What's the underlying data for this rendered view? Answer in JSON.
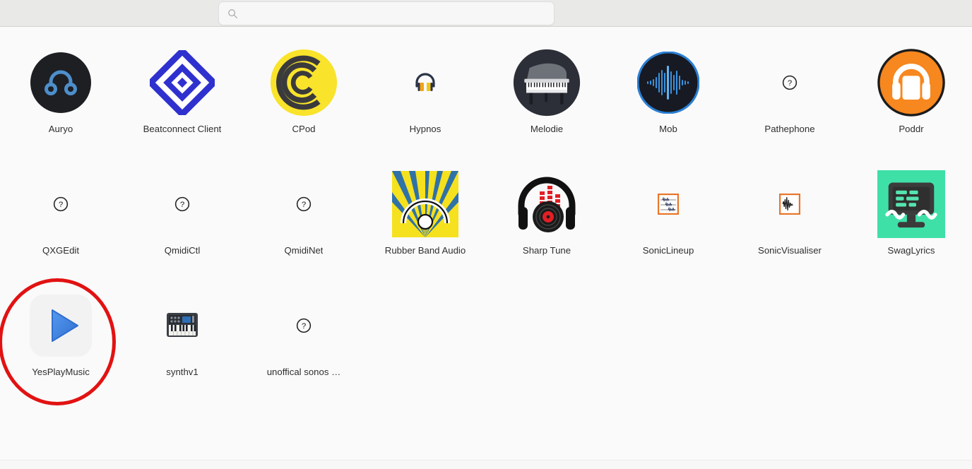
{
  "search": {
    "placeholder": "",
    "value": "",
    "icon": "search-icon"
  },
  "highlight": {
    "target": "YesPlayMusic",
    "color": "#e21212",
    "shape": "ellipse"
  },
  "colors": {
    "background": "#fafafa",
    "topbar": "#e9e9e8",
    "label_text": "#2f2f2f",
    "search_field": "#f7f7f7",
    "accent_red": "#e21212"
  },
  "grid": {
    "columns": 8,
    "rows": [
      [
        {
          "label": "Auryo",
          "icon": "auryo-icon"
        },
        {
          "label": "Beatconnect Client",
          "icon": "beatconnect-icon"
        },
        {
          "label": "CPod",
          "icon": "cpod-icon"
        },
        {
          "label": "Hypnos",
          "icon": "hypnos-icon"
        },
        {
          "label": "Melodie",
          "icon": "melodie-icon"
        },
        {
          "label": "Mob",
          "icon": "mob-icon"
        },
        {
          "label": "Pathephone",
          "icon": "placeholder-question-icon"
        },
        {
          "label": "Poddr",
          "icon": "poddr-icon"
        }
      ],
      [
        {
          "label": "QXGEdit",
          "icon": "placeholder-question-icon"
        },
        {
          "label": "QmidiCtl",
          "icon": "placeholder-question-icon"
        },
        {
          "label": "QmidiNet",
          "icon": "placeholder-question-icon"
        },
        {
          "label": "Rubber Band Audio",
          "icon": "rubberband-icon"
        },
        {
          "label": "Sharp Tune",
          "icon": "sharptune-icon"
        },
        {
          "label": "SonicLineup",
          "icon": "soniclineup-icon"
        },
        {
          "label": "SonicVisualiser",
          "icon": "sonicvisualiser-icon"
        },
        {
          "label": "SwagLyrics",
          "icon": "swaglyrics-icon"
        }
      ],
      [
        {
          "label": "YesPlayMusic",
          "icon": "yesplaymusic-icon"
        },
        {
          "label": "synthv1",
          "icon": "synthv1-icon"
        },
        {
          "label": "unoffical sonos …",
          "icon": "placeholder-question-icon"
        }
      ]
    ]
  }
}
